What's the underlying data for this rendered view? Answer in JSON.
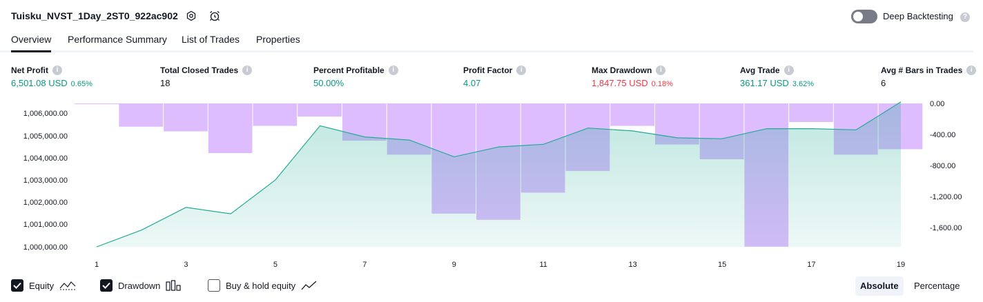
{
  "header": {
    "strategy_name": "Tuisku_NVST_1Day_2ST0_922ac902",
    "deep_backtesting_label": "Deep Backtesting",
    "deep_backtesting_enabled": false
  },
  "tabs": [
    {
      "label": "Overview",
      "active": true
    },
    {
      "label": "Performance Summary",
      "active": false
    },
    {
      "label": "List of Trades",
      "active": false
    },
    {
      "label": "Properties",
      "active": false
    }
  ],
  "metrics": [
    {
      "label": "Net Profit",
      "value": "6,501.08 USD",
      "pct": "0.65%",
      "tone": "pos"
    },
    {
      "label": "Total Closed Trades",
      "value": "18",
      "pct": "",
      "tone": "neu"
    },
    {
      "label": "Percent Profitable",
      "value": "50.00%",
      "pct": "",
      "tone": "pos"
    },
    {
      "label": "Profit Factor",
      "value": "4.07",
      "pct": "",
      "tone": "pos"
    },
    {
      "label": "Max Drawdown",
      "value": "1,847.75 USD",
      "pct": "0.18%",
      "tone": "neg"
    },
    {
      "label": "Avg Trade",
      "value": "361.17 USD",
      "pct": "3.62%",
      "tone": "pos"
    },
    {
      "label": "Avg # Bars in Trades",
      "value": "6",
      "pct": "",
      "tone": "neu"
    }
  ],
  "colors": {
    "positive": "#089981",
    "negative": "#f23645",
    "equity_line": "#22ab94",
    "drawdown_bar": "#d1a3ff"
  },
  "chart_data": {
    "type": "line+bar",
    "x": [
      1,
      2,
      3,
      4,
      5,
      6,
      7,
      8,
      9,
      10,
      11,
      12,
      13,
      14,
      15,
      16,
      17,
      18,
      19
    ],
    "x_tick_labels": [
      "1",
      "3",
      "5",
      "7",
      "9",
      "11",
      "13",
      "15",
      "17",
      "19"
    ],
    "left_axis": {
      "ticks": [
        "1,006,000.00",
        "1,005,000.00",
        "1,004,000.00",
        "1,003,000.00",
        "1,002,000.00",
        "1,001,000.00",
        "1,000,000.00"
      ],
      "tick_values": [
        1006000,
        1005000,
        1004000,
        1003000,
        1002000,
        1001000,
        1000000
      ],
      "range": [
        1000000,
        1006500
      ]
    },
    "right_axis": {
      "ticks": [
        "0.00",
        "-400.00",
        "-800.00",
        "-1,200.00",
        "-1,600.00"
      ],
      "tick_values": [
        0,
        -400,
        -800,
        -1200,
        -1600
      ],
      "range": [
        -1850,
        0
      ]
    },
    "series": [
      {
        "name": "Equity",
        "type": "area",
        "values": [
          1000000,
          1000750,
          1001770,
          1001480,
          1003000,
          1005430,
          1004930,
          1004790,
          1004040,
          1004480,
          1004600,
          1005330,
          1005200,
          1004890,
          1004850,
          1005300,
          1005300,
          1005250,
          1006500
        ]
      },
      {
        "name": "Drawdown",
        "type": "bar",
        "values": [
          -10,
          -300,
          -360,
          -640,
          -290,
          -170,
          -480,
          -660,
          -1420,
          -1500,
          -1150,
          -870,
          -290,
          -530,
          -720,
          -1847,
          -240,
          -660,
          -590
        ]
      }
    ]
  },
  "legend": [
    {
      "label": "Equity",
      "checked": true,
      "icon": "equity-line-icon"
    },
    {
      "label": "Drawdown",
      "checked": true,
      "icon": "drawdown-bars-icon"
    },
    {
      "label": "Buy & hold equity",
      "checked": false,
      "icon": "buy-hold-line-icon"
    }
  ],
  "view_mode": {
    "options": [
      "Absolute",
      "Percentage"
    ],
    "selected": "Absolute"
  }
}
